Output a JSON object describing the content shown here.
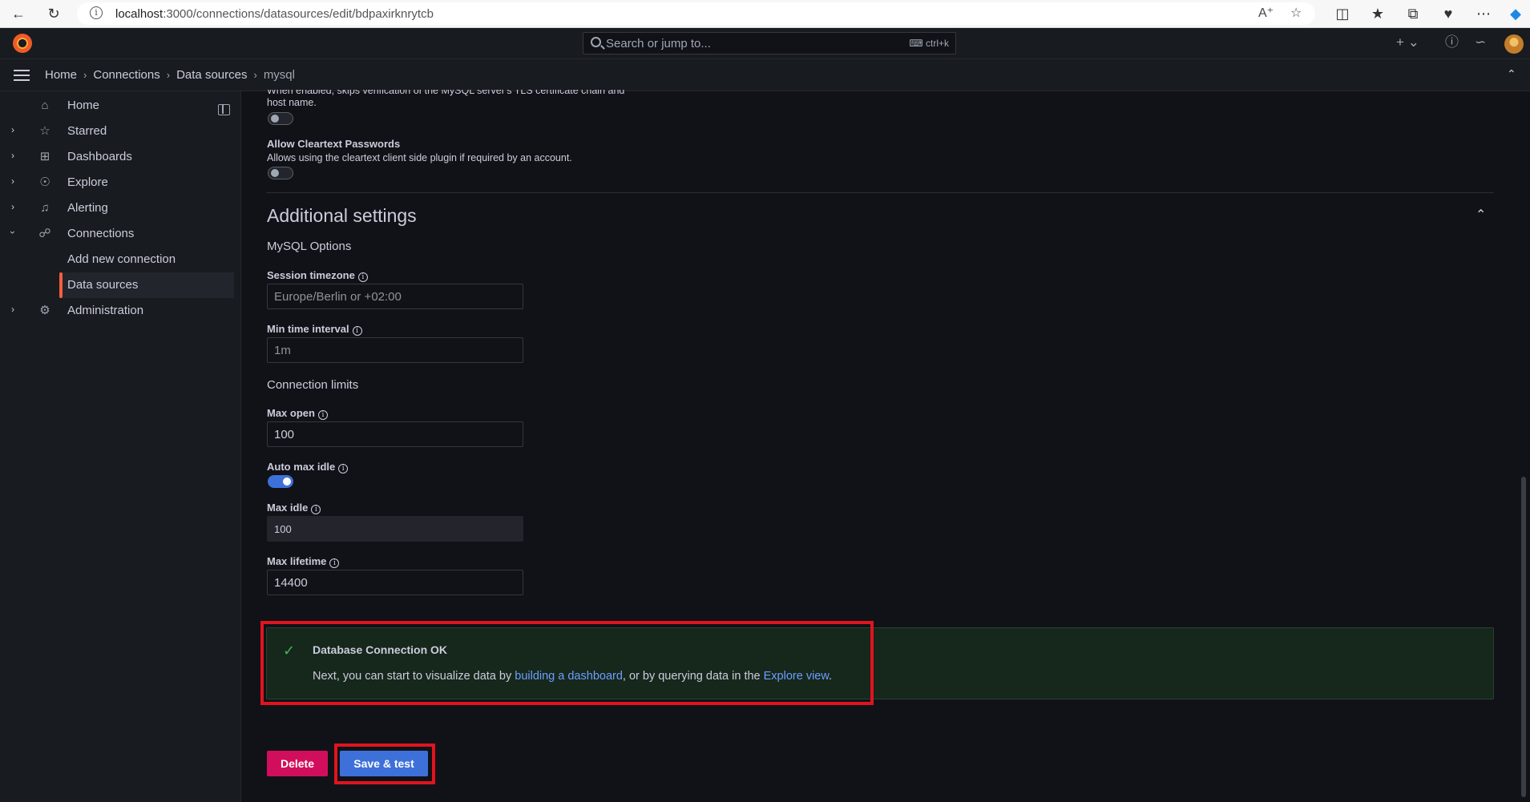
{
  "browser": {
    "url_host": "localhost",
    "url_rest": ":3000/connections/datasources/edit/bdpaxirknrytcb"
  },
  "topbar": {
    "search_placeholder": "Search or jump to...",
    "search_shortcut": "ctrl+k"
  },
  "breadcrumbs": [
    "Home",
    "Connections",
    "Data sources",
    "mysql"
  ],
  "sidebar": {
    "items": [
      {
        "label": "Home",
        "icon": "home-icon"
      },
      {
        "label": "Starred",
        "icon": "star-icon"
      },
      {
        "label": "Dashboards",
        "icon": "apps-icon"
      },
      {
        "label": "Explore",
        "icon": "compass-icon"
      },
      {
        "label": "Alerting",
        "icon": "bell-icon"
      },
      {
        "label": "Connections",
        "icon": "connections-icon"
      },
      {
        "label": "Add new connection"
      },
      {
        "label": "Data sources"
      },
      {
        "label": "Administration",
        "icon": "cog-icon"
      }
    ]
  },
  "form": {
    "skip_tls_desc_line1": "When enabled, skips verification of the MySQL server's TLS certificate chain and",
    "skip_tls_desc_line2": "host name.",
    "cleartext_label": "Allow Cleartext Passwords",
    "cleartext_desc": "Allows using the cleartext client side plugin if required by an account.",
    "additional_settings_title": "Additional settings",
    "mysql_options_title": "MySQL Options",
    "session_timezone_label": "Session timezone",
    "session_timezone_placeholder": "Europe/Berlin or +02:00",
    "min_time_interval_label": "Min time interval",
    "min_time_interval_placeholder": "1m",
    "connection_limits_title": "Connection limits",
    "max_open_label": "Max open",
    "max_open_value": "100",
    "auto_max_idle_label": "Auto max idle",
    "auto_max_idle_on": true,
    "max_idle_label": "Max idle",
    "max_idle_value": "100",
    "max_lifetime_label": "Max lifetime",
    "max_lifetime_value": "14400"
  },
  "alert": {
    "title": "Database Connection OK",
    "body_prefix": "Next, you can start to visualize data by ",
    "link_dashboard": "building a dashboard",
    "body_middle": ", or by querying data in the ",
    "link_explore": "Explore view",
    "body_suffix": "."
  },
  "buttons": {
    "delete": "Delete",
    "save_test": "Save & test"
  },
  "colors": {
    "accent_blue": "#3d71d9",
    "delete_red": "#d10e5c",
    "success_green": "#3fb950",
    "highlight_red": "#e0141f",
    "active_orange": "#f55f3e"
  }
}
